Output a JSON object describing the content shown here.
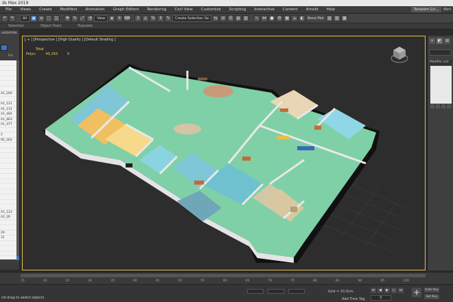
{
  "app": {
    "title": "ds Max 2019"
  },
  "menu": [
    "File",
    "Views",
    "Create",
    "Modifiers",
    "Animation",
    "Graph Editors",
    "Rendering",
    "Civil View",
    "Customize",
    "Scripting",
    "Interactive",
    "Content",
    "Arnold",
    "Help"
  ],
  "user": {
    "name": "Tamjeem Gri...",
    "workspace": "Worl"
  },
  "toolbar": {
    "selection_filter": "All",
    "view_dropdown": "View",
    "named_selection": "Create Selection Se",
    "bend_mat": "Bend Mat"
  },
  "ribbon": [
    "Selection",
    "Object Paint",
    "Populate"
  ],
  "scene_explorer": {
    "header": "ustomize",
    "column": "Fro",
    "rows": [
      "",
      "",
      "",
      "",
      "",
      "",
      "A1_200",
      "",
      "A1_121",
      "A1_131",
      "A1_492",
      "A1_663",
      "A1_477",
      "",
      "2",
      "95_303",
      "",
      "",
      "",
      "",
      "",
      "",
      "",
      "",
      "",
      "",
      "",
      "",
      "",
      "A1_123",
      "A2_30",
      "",
      "",
      "29",
      "31",
      "",
      "",
      ""
    ]
  },
  "viewport": {
    "label": "[ + ] [Perspective ] [High Quality ] [Default Shading ]",
    "stats_total_label": "Total",
    "stats_polys_label": "Polys:",
    "stats_polys_value": "45,293",
    "stats_selected": "0"
  },
  "command_panel": {
    "modifier_list": "Modifier List"
  },
  "timeline": {
    "ticks": [
      "15",
      "20",
      "25",
      "30",
      "35",
      "40",
      "45",
      "50",
      "55",
      "60",
      "65",
      "70",
      "75",
      "80",
      "85",
      "90",
      "95",
      "100"
    ]
  },
  "status": {
    "prompt": "nd-drag to select objects",
    "grid": "Grid = 10.0cm",
    "add_time_tag": "Add Time Tag",
    "frame": "0",
    "auto_key": "Auto Key",
    "set_key": "Set Key"
  },
  "colors": {
    "accent": "#3a78c2",
    "viewport_border": "#e8c24a",
    "floor": "#7fd0a6"
  }
}
